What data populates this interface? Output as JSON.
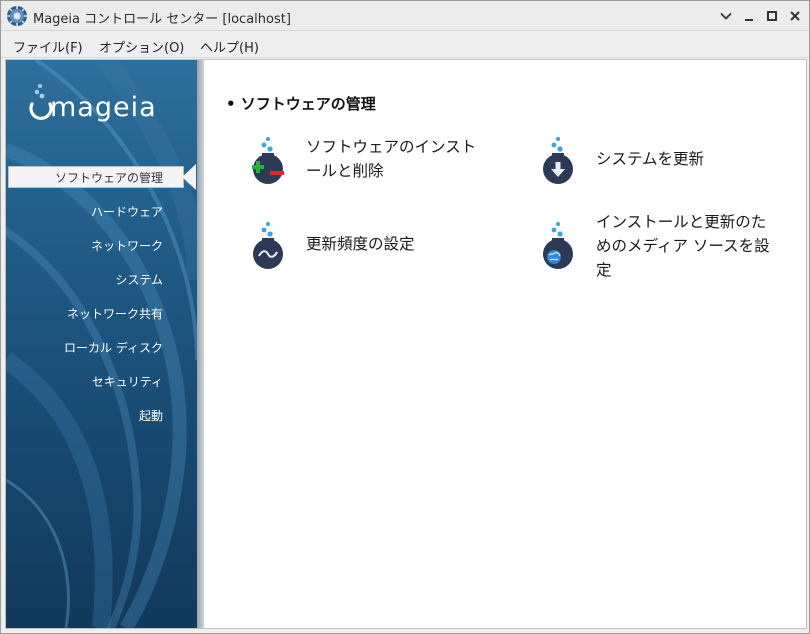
{
  "window": {
    "title": "Mageia コントロール センター  [localhost]"
  },
  "menubar": {
    "items": [
      "ファイル(F)",
      "オプション(O)",
      "ヘルプ(H)"
    ]
  },
  "sidebar": {
    "logo_text": "mageia",
    "active_index": 0,
    "items": [
      {
        "label": "ソフトウェアの管理"
      },
      {
        "label": "ハードウェア"
      },
      {
        "label": "ネットワーク"
      },
      {
        "label": "システム"
      },
      {
        "label": "ネットワーク共有"
      },
      {
        "label": "ローカル ディスク"
      },
      {
        "label": "セキュリティ"
      },
      {
        "label": "起動"
      }
    ]
  },
  "main": {
    "section_title": "• ソフトウェアの管理",
    "tools": [
      {
        "label_line1": "ソフトウェアのインスト",
        "label_line2": "ールと削除",
        "icon": "install-remove-icon"
      },
      {
        "label_line1": "システムを更新",
        "icon": "update-system-icon"
      },
      {
        "label_line1": "更新頻度の設定",
        "icon": "update-frequency-icon"
      },
      {
        "label_line1": "インストールと更新のた",
        "label_line2": "めのメディア ソースを設",
        "label_line3": "定",
        "icon": "media-sources-icon"
      }
    ]
  },
  "colors": {
    "sidebar_top": "#2f6f9b",
    "sidebar_bottom": "#12395a",
    "icon_body": "#2d3a55",
    "bubble": "#3da2e0",
    "add_green": "#27b03a",
    "remove_red": "#e0262a"
  }
}
